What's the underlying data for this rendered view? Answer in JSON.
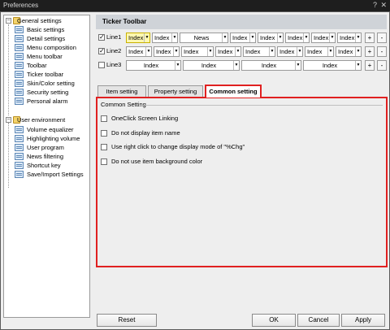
{
  "window": {
    "title": "Preferences",
    "help_glyph": "?",
    "close_glyph": "✕"
  },
  "tree": {
    "groups": [
      {
        "label": "General settings",
        "expander": "−",
        "items": [
          "Basic settings",
          "Detail settings",
          "Menu composition",
          "Menu toolbar",
          "Toolbar",
          "Ticker toolbar",
          "Skin/Color setting",
          "Security setting",
          "Personal alarm"
        ]
      },
      {
        "label": "User environment",
        "expander": "−",
        "items": [
          "Volume equalizer",
          "Highlighting volume",
          "User program",
          "News filtering",
          "Shortcut key",
          "Save/Import Settings"
        ]
      }
    ]
  },
  "panel_title": "Ticker Toolbar",
  "lines": [
    {
      "label": "Line1",
      "checked": true,
      "dropdowns": [
        "Index",
        "Index",
        "News",
        "Index",
        "Index",
        "Index",
        "Index",
        "Index"
      ]
    },
    {
      "label": "Line2",
      "checked": true,
      "dropdowns": [
        "Index",
        "Index",
        "Index",
        "Index",
        "Index",
        "Index",
        "Index",
        "Index"
      ]
    },
    {
      "label": "Line3",
      "checked": false,
      "dropdowns": [
        "Index",
        "Index",
        "Index",
        "Index"
      ]
    }
  ],
  "line_buttons": {
    "add": "+",
    "remove": "-"
  },
  "dropdown_arrow": "▼",
  "tabs": [
    "Item setting",
    "Property setting",
    "Common setting"
  ],
  "active_tab": "Common setting",
  "common_setting": {
    "group_title": "Common Setting",
    "options": [
      {
        "label": "OneClick Screen Linking",
        "checked": false
      },
      {
        "label": "Do not display item name",
        "checked": false
      },
      {
        "label": "Use right click to change display mode of \"%Chg\"",
        "checked": false
      },
      {
        "label": "Do not use item background color",
        "checked": false
      }
    ]
  },
  "buttons": {
    "reset": "Reset",
    "ok": "OK",
    "cancel": "Cancel",
    "apply": "Apply"
  },
  "colors": {
    "highlight_border": "#e02020",
    "header_bg": "#cfd3d8",
    "titlebar_bg": "#1e1e1e"
  }
}
